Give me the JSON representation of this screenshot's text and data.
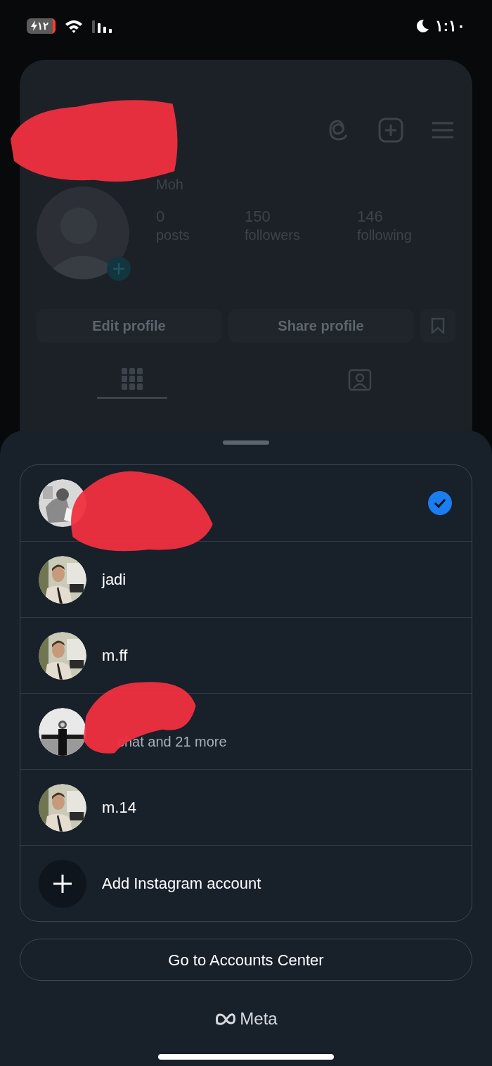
{
  "status_bar": {
    "battery": "١٢",
    "time": "١:١٠"
  },
  "profile": {
    "name": "Moh",
    "stats": [
      {
        "value": "0",
        "label": "posts"
      },
      {
        "value": "150",
        "label": "followers"
      },
      {
        "value": "146",
        "label": "following"
      }
    ],
    "buttons": [
      "Edit profile",
      "Share profile"
    ],
    "tabs": [
      {
        "kind": "grid",
        "selected": true
      },
      {
        "kind": "tagged",
        "selected": false
      }
    ]
  },
  "accounts": [
    {
      "kind": "account",
      "selected": true
    },
    {
      "kind": "account",
      "name": "jadi",
      "selected": false
    },
    {
      "kind": "account",
      "name": "m.ff",
      "selected": false
    },
    {
      "kind": "account",
      "subtitle": "chat and 21 more",
      "selected": false
    },
    {
      "kind": "account",
      "name": "m.14",
      "selected": false
    },
    {
      "kind": "add",
      "name": "Add Instagram account"
    }
  ],
  "accounts_center_button": "Go to Accounts Center",
  "brand": "Meta"
}
